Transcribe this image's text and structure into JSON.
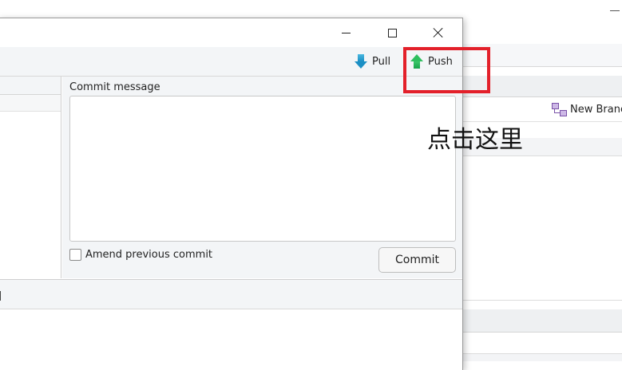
{
  "toolbar": {
    "pull_label": "Pull",
    "push_label": "Push"
  },
  "background_window": {
    "new_branch_label": "New Branc"
  },
  "commit": {
    "message_label": "Commit message",
    "message_value": "",
    "amend_label": "Amend previous commit",
    "amend_checked": false,
    "commit_button_label": "Commit"
  },
  "annotation": {
    "text": "点击这里",
    "highlight_color": "#e3202a"
  },
  "icons": {
    "pull": "arrow-down-icon",
    "push": "arrow-up-icon",
    "new_branch": "branch-icon"
  },
  "colors": {
    "pull_arrow": "#1b8fc4",
    "push_arrow": "#2fbf5e"
  }
}
